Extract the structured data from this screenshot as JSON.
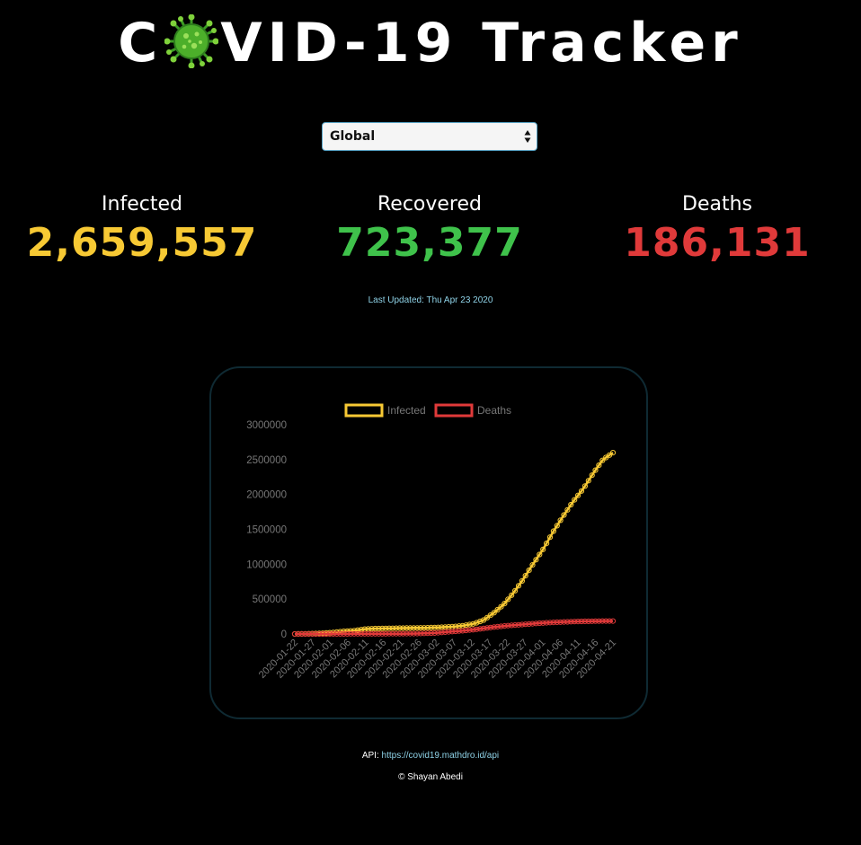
{
  "header": {
    "title_prefix": "C",
    "title_suffix": "VID-19 Tracker",
    "logo_icon": "virus-icon"
  },
  "country_picker": {
    "selected": "Global",
    "icon": "select-arrows-icon"
  },
  "stats": {
    "infected": {
      "label": "Infected",
      "value": "2,659,557",
      "color": "#f7c934"
    },
    "recovered": {
      "label": "Recovered",
      "value": "723,377",
      "color": "#3fc24b"
    },
    "deaths": {
      "label": "Deaths",
      "value": "186,131",
      "color": "#e03a3a"
    }
  },
  "last_updated": "Last Updated: Thu Apr 23 2020",
  "footer": {
    "api_label": "API: ",
    "api_link": "https://covid19.mathdro.id/api",
    "copyright": "© Shayan Abedi"
  },
  "chart_data": {
    "type": "line",
    "title": "",
    "xlabel": "",
    "ylabel": "",
    "ylim": [
      0,
      3000000
    ],
    "y_ticks": [
      "0",
      "500000",
      "1000000",
      "1500000",
      "2000000",
      "2500000",
      "3000000"
    ],
    "x_tick_labels": [
      "2020-01-22",
      "2020-01-27",
      "2020-02-01",
      "2020-02-06",
      "2020-02-11",
      "2020-02-16",
      "2020-02-21",
      "2020-02-26",
      "2020-03-02",
      "2020-03-07",
      "2020-03-12",
      "2020-03-17",
      "2020-03-22",
      "2020-03-27",
      "2020-04-01",
      "2020-04-06",
      "2020-04-11",
      "2020-04-16",
      "2020-04-21"
    ],
    "grid": false,
    "legend_placement": "top-center",
    "x_start": "2020-01-22",
    "x_end": "2020-04-22",
    "series": [
      {
        "name": "Infected",
        "color": "#f7c934",
        "values": [
          555,
          2200,
          6000,
          12000,
          24000,
          38000,
          48000,
          69000,
          77000,
          79000,
          82000,
          84000,
          86000,
          88000,
          92000,
          98000,
          106000,
          120000,
          146000,
          200000,
          300000,
          420000,
          590000,
          790000,
          1010000,
          1220000,
          1470000,
          1690000,
          1900000,
          2080000,
          2300000,
          2500000,
          2600000
        ]
      },
      {
        "name": "Deaths",
        "color": "#e03a3a",
        "values": [
          17,
          56,
          259,
          565,
          1018,
          1526,
          2248,
          2469,
          2801,
          3097,
          3460,
          4262,
          5833,
          9000,
          14000,
          25000,
          37000,
          48000,
          62000,
          80000,
          98000,
          114000,
          126000,
          137000,
          148000,
          158000,
          166000,
          172000,
          177000,
          181000,
          183000,
          185000,
          186000
        ]
      }
    ]
  }
}
